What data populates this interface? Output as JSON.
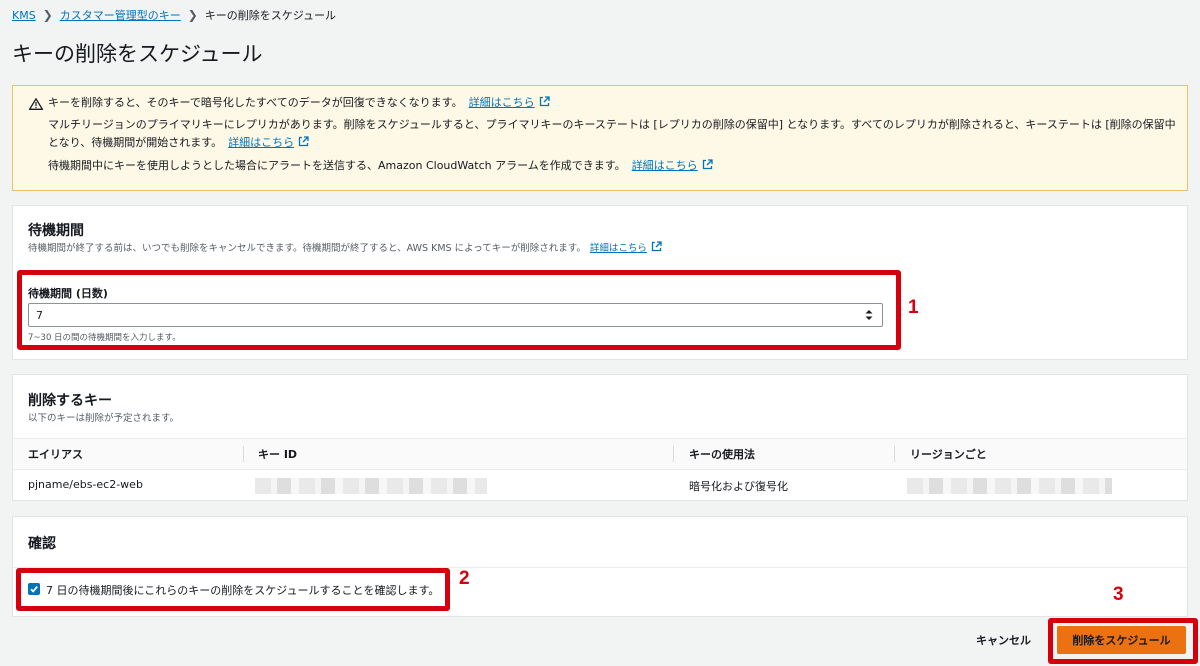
{
  "breadcrumb": {
    "kms": "KMS",
    "customer_keys": "カスタマー管理型のキー",
    "current": "キーの削除をスケジュール"
  },
  "page_title": "キーの削除をスケジュール",
  "alert": {
    "line1": "キーを削除すると、そのキーで暗号化したすべてのデータが回復できなくなります。",
    "line2": "マルチリージョンのプライマリキーにレプリカがあります。削除をスケジュールすると、プライマリキーのキーステートは [レプリカの削除の保留中] となります。すべてのレプリカが削除されると、キーステートは [削除の保留中",
    "line3": "となり、待機期間が開始されます。",
    "line4": "待機期間中にキーを使用しようとした場合にアラートを送信する、Amazon CloudWatch アラームを作成できます。",
    "link": "詳細はこちら"
  },
  "waiting_period": {
    "title": "待機期間",
    "description": "待機期間が終了する前は、いつでも削除をキャンセルできます。待機期間が終了すると、AWS KMS によってキーが削除されます。",
    "link": "詳細はこちら",
    "field_label": "待機期間 (日数)",
    "value": "7",
    "hint": "7~30 日の間の待機期間を入力します。"
  },
  "keys_to_delete": {
    "title": "削除するキー",
    "description": "以下のキーは削除が予定されます。",
    "columns": [
      "エイリアス",
      "キー ID",
      "キーの使用法",
      "リージョンごと"
    ],
    "rows": [
      {
        "alias": "pjname/ebs-ec2-web",
        "usage": "暗号化および復号化"
      }
    ]
  },
  "confirm": {
    "title": "確認",
    "checkbox_label": "7 日の待機期間後にこれらのキーの削除をスケジュールすることを確認します。",
    "checked": true
  },
  "footer": {
    "cancel": "キャンセル",
    "submit": "削除をスケジュール"
  },
  "annotations": [
    "1",
    "2",
    "3"
  ],
  "colors": {
    "link": "#0073bb",
    "primary": "#ec7211",
    "annotation": "#d6000c",
    "alert_bg": "#fef9e7"
  }
}
